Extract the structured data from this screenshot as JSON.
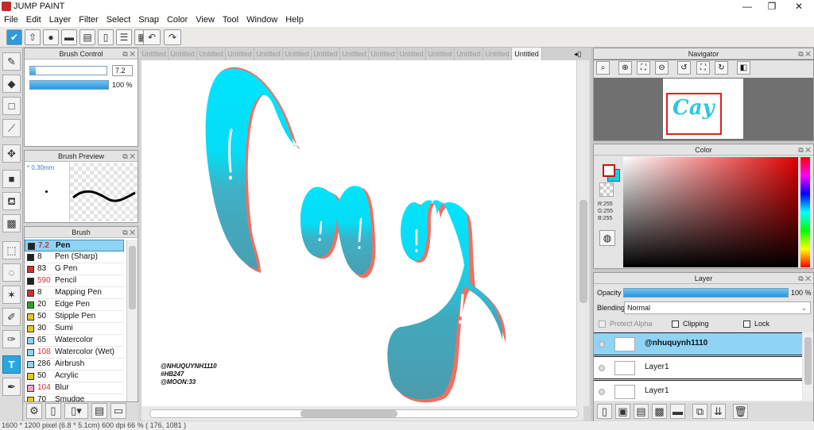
{
  "app": {
    "title": "JUMP PAINT",
    "min": "—",
    "max": "❐",
    "close": "✕"
  },
  "menu": [
    "File",
    "Edit",
    "Layer",
    "Filter",
    "Select",
    "Snap",
    "Color",
    "View",
    "Tool",
    "Window",
    "Help"
  ],
  "toolbar": {
    "icons": [
      "check-icon",
      "upload-icon",
      "chat-icon",
      "comment-icon",
      "document-icon",
      "page-icon",
      "list-icon",
      "grid-icon"
    ],
    "undo": "↶",
    "redo": "↷"
  },
  "brush_control": {
    "title": "Brush Control",
    "size": "7.2",
    "size_fraction": 0.07,
    "opacity": "100 %",
    "opacity_fraction": 1.0
  },
  "brush_preview": {
    "title": "Brush Preview",
    "size_label": "* 0.30mm"
  },
  "brush": {
    "title": "Brush",
    "items": [
      {
        "size": "7.2",
        "name": "Pen",
        "color": "#222222",
        "selected": true,
        "size_red": true
      },
      {
        "size": "8",
        "name": "Pen (Sharp)",
        "color": "#222222"
      },
      {
        "size": "83",
        "name": "G Pen",
        "color": "#d32f2f"
      },
      {
        "size": "590",
        "name": "Pencil",
        "color": "#222222",
        "size_red": true
      },
      {
        "size": "8",
        "name": "Mapping Pen",
        "color": "#d32f2f"
      },
      {
        "size": "20",
        "name": "Edge Pen",
        "color": "#2e9e2e"
      },
      {
        "size": "50",
        "name": "Stipple Pen",
        "color": "#e5c71e"
      },
      {
        "size": "30",
        "name": "Sumi",
        "color": "#e5c71e"
      },
      {
        "size": "65",
        "name": "Watercolor",
        "color": "#8ad4f2"
      },
      {
        "size": "108",
        "name": "Watercolor (Wet)",
        "color": "#8ad4f2",
        "size_red": true
      },
      {
        "size": "286",
        "name": "Airbrush",
        "color": "#8ad4f2"
      },
      {
        "size": "50",
        "name": "Acrylic",
        "color": "#e5c71e"
      },
      {
        "size": "104",
        "name": "Blur",
        "color": "#f4a0c8",
        "size_red": true
      },
      {
        "size": "70",
        "name": "Smudge",
        "color": "#e5c71e"
      }
    ]
  },
  "tabs": [
    "Untitled",
    "Untitled",
    "Untitled",
    "Untitled",
    "Untitled",
    "Untitled",
    "Untitled",
    "Untitled",
    "Untitled",
    "Untitled",
    "Untitled",
    "Untitled",
    "Untitled",
    "Untitled"
  ],
  "canvas": {
    "lettering": "Cay",
    "credits": [
      "@NHUQUYNH1110",
      "#HB247",
      "@MOON:33"
    ]
  },
  "navigator": {
    "title": "Navigator"
  },
  "color": {
    "title": "Color",
    "r": "R:255",
    "g": "G:255",
    "b": "B:255",
    "fg": "#ffffff",
    "bg": "#00d4f0"
  },
  "layer": {
    "title": "Layer",
    "opacity_label": "Opacity",
    "opacity": "100 %",
    "opacity_fraction": 1.0,
    "blending_label": "Blending",
    "blending": "Normal",
    "protect_alpha": "Protect Alpha",
    "clipping": "Clipping",
    "lock": "Lock",
    "items": [
      {
        "name": "@nhuquynh1110",
        "selected": true
      },
      {
        "name": "Layer1"
      },
      {
        "name": "Layer1"
      }
    ]
  },
  "status": "1600 * 1200 pixel  (6.8 * 5.1cm)  600 dpi  66 %  ( 176, 1081 )",
  "colors": {
    "accent": "#29a8e0",
    "selected_row": "#8fd3f5",
    "letter_cyan": "#00e5ff",
    "letter_teal": "#3aa0b4",
    "letter_shadow": "#f07060"
  }
}
